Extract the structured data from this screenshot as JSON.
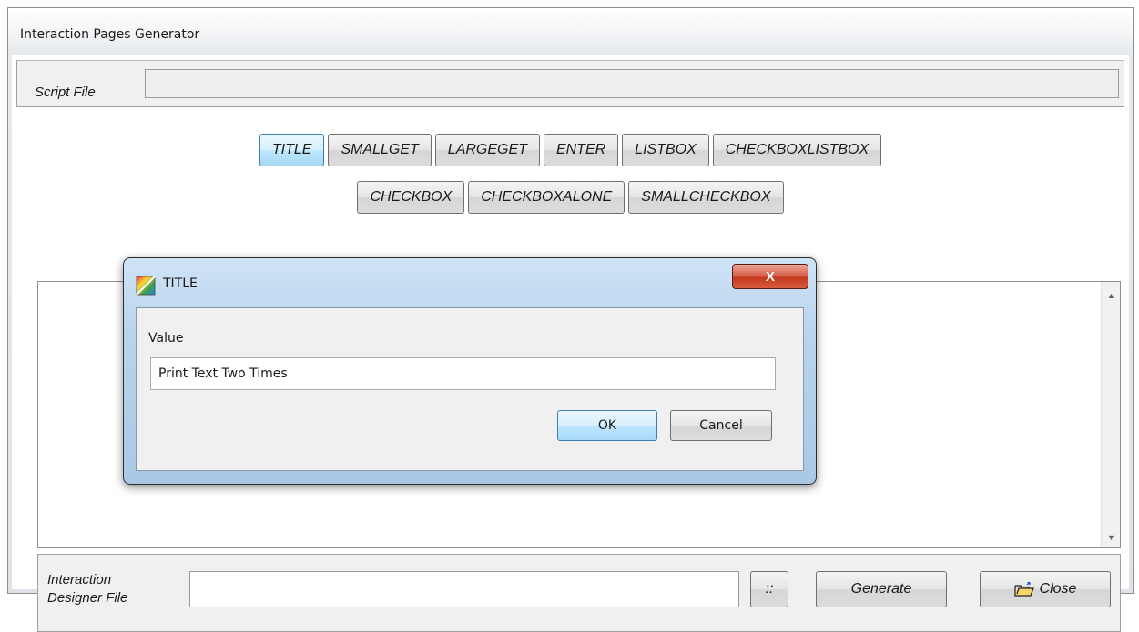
{
  "window": {
    "title": "Interaction Pages Generator"
  },
  "script_file": {
    "label": "Script File",
    "value": ""
  },
  "toolbar": {
    "row1": [
      "TITLE",
      "SMALLGET",
      "LARGEGET",
      "ENTER",
      "LISTBOX",
      "CHECKBOXLISTBOX"
    ],
    "row2": [
      "CHECKBOX",
      "CHECKBOXALONE",
      "SMALLCHECKBOX"
    ],
    "active": "TITLE"
  },
  "dialog": {
    "title": "TITLE",
    "close_label": "X",
    "value_label": "Value",
    "value": "Print Text Two Times",
    "ok_label": "OK",
    "cancel_label": "Cancel"
  },
  "bottom": {
    "designer_label_line1": "Interaction",
    "designer_label_line2": "Designer File",
    "designer_value": "",
    "browse_label": "::",
    "generate_label": "Generate",
    "close_label": "Close"
  },
  "colors": {
    "active_button": "#bee6fd",
    "dialog_close": "#c5391f"
  },
  "icons": {
    "dialog": "app-icon",
    "close_button": "folder-open-icon"
  }
}
